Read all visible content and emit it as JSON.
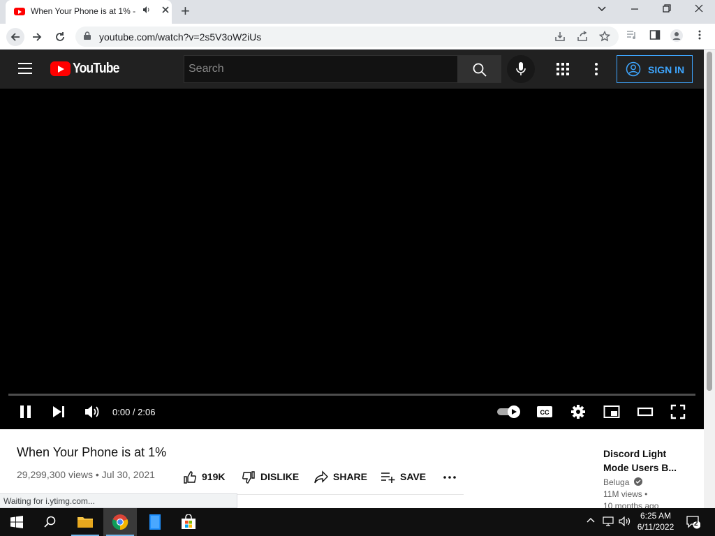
{
  "browser": {
    "tab_title": "When Your Phone is at 1% -",
    "tab_audio_icon": "speaker-icon",
    "new_tab_label": "+",
    "window_controls": {
      "dropdown": "⌄",
      "minimize": "—",
      "restore": "❐",
      "close": "✕"
    },
    "url": "youtube.com/watch?v=2s5V3oW2iUs"
  },
  "youtube": {
    "logo_text": "YouTube",
    "search_placeholder": "Search",
    "sign_in_label": "SIGN IN",
    "brand_red": "#ff0000",
    "accent_blue": "#3ea6ff"
  },
  "player": {
    "time_display": "0:00 / 2:06",
    "progress_fraction": 0,
    "playing": true
  },
  "video": {
    "title": "When Your Phone is at 1%",
    "views": "29,299,300 views",
    "date_separator": "•",
    "date": "Jul 30, 2021",
    "like_count": "919K",
    "dislike_label": "DISLIKE",
    "share_label": "SHARE",
    "save_label": "SAVE"
  },
  "suggestion": {
    "title": "Discord Light Mode Users B...",
    "channel": "Beluga",
    "views": "11M views •",
    "age": "10 months ago"
  },
  "status_bar": {
    "text": "Waiting for i.ytimg.com..."
  },
  "taskbar": {
    "time": "6:25 AM",
    "date": "6/11/2022",
    "notification_count": "2"
  }
}
